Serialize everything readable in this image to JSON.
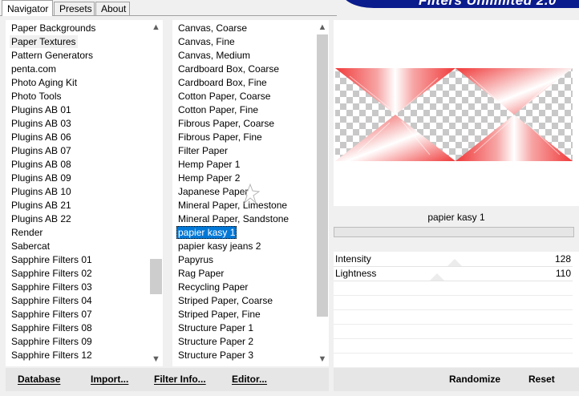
{
  "tabs": [
    {
      "label": "Navigator",
      "active": true
    },
    {
      "label": "Presets",
      "active": false
    },
    {
      "label": "About",
      "active": false
    }
  ],
  "brand": {
    "title": "Filters Unlimited 2.0",
    "color": "#0b1c8c"
  },
  "categories": {
    "items": [
      "Paper Backgrounds",
      "Paper Textures",
      "Pattern Generators",
      "penta.com",
      "Photo Aging Kit",
      "Photo Tools",
      "Plugins AB 01",
      "Plugins AB 03",
      "Plugins AB 06",
      "Plugins AB 07",
      "Plugins AB 08",
      "Plugins AB 09",
      "Plugins AB 10",
      "Plugins AB 21",
      "Plugins AB 22",
      "Render",
      "Sabercat",
      "Sapphire Filters 01",
      "Sapphire Filters 02",
      "Sapphire Filters 03",
      "Sapphire Filters 04",
      "Sapphire Filters 07",
      "Sapphire Filters 08",
      "Sapphire Filters 09",
      "Sapphire Filters 12"
    ],
    "selected": "Paper Textures"
  },
  "filters": {
    "items": [
      "Canvas, Coarse",
      "Canvas, Fine",
      "Canvas, Medium",
      "Cardboard Box, Coarse",
      "Cardboard Box, Fine",
      "Cotton Paper, Coarse",
      "Cotton Paper, Fine",
      "Fibrous Paper, Coarse",
      "Fibrous Paper, Fine",
      "Filter Paper",
      "Hemp Paper 1",
      "Hemp Paper 2",
      "Japanese Paper",
      "Mineral Paper, Limestone",
      "Mineral Paper, Sandstone",
      "papier kasy 1",
      "papier kasy jeans 2",
      "Papyrus",
      "Rag Paper",
      "Recycling Paper",
      "Striped Paper, Coarse",
      "Striped Paper, Fine",
      "Structure Paper 1",
      "Structure Paper 2",
      "Structure Paper 3"
    ],
    "selected": "papier kasy 1"
  },
  "preview": {
    "filter_name": "papier kasy 1",
    "accent": "#f03a3a"
  },
  "params": [
    {
      "label": "Intensity",
      "value": "128"
    },
    {
      "label": "Lightness",
      "value": "110"
    }
  ],
  "buttons": {
    "database": "Database",
    "import": "Import...",
    "filter_info": "Filter Info...",
    "editor": "Editor...",
    "randomize": "Randomize",
    "reset": "Reset"
  },
  "colors": {
    "selection": "#0078d7",
    "panel": "#ffffff",
    "window": "#f0f0f0"
  }
}
